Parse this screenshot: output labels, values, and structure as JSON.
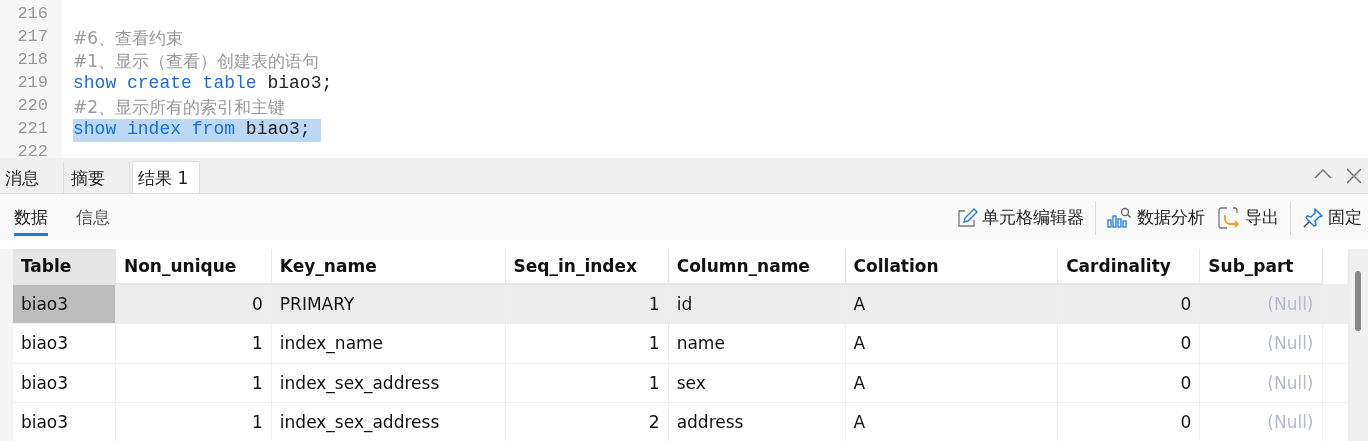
{
  "editor": {
    "lines": [
      {
        "number": "216",
        "selected": false
      },
      {
        "number": "217",
        "selected": false,
        "segments": [
          {
            "kind": "comment",
            "text": "#6、查看约束"
          }
        ]
      },
      {
        "number": "218",
        "selected": false,
        "segments": [
          {
            "kind": "comment",
            "text": "#1、显示（查看）创建表的语句"
          }
        ]
      },
      {
        "number": "219",
        "selected": false,
        "segments": [
          {
            "kind": "keyword",
            "text": "show create table"
          },
          {
            "kind": "plain",
            "text": " biao3;"
          }
        ]
      },
      {
        "number": "220",
        "selected": false,
        "segments": [
          {
            "kind": "comment",
            "text": "#2、显示所有的索引和主键"
          }
        ]
      },
      {
        "number": "221",
        "selected": true,
        "segments": [
          {
            "kind": "keyword",
            "text": "show index from"
          },
          {
            "kind": "plain",
            "text": " biao3; "
          }
        ]
      },
      {
        "number": "222",
        "selected": false
      }
    ]
  },
  "result_tabs": [
    {
      "label": "消息",
      "selected": false
    },
    {
      "label": "摘要",
      "selected": false
    },
    {
      "label": "结果 1",
      "selected": true
    }
  ],
  "view_tabs": [
    {
      "label": "数据",
      "selected": true
    },
    {
      "label": "信息",
      "selected": false
    }
  ],
  "toolbar": [
    {
      "kind": "edit",
      "label": "单元格编辑器"
    },
    {
      "kind": "analyze",
      "label": "数据分析"
    },
    {
      "kind": "export",
      "label": "导出"
    },
    {
      "kind": "pin",
      "label": "固定"
    }
  ],
  "table": {
    "columns": [
      {
        "label": "Table",
        "kind": "text"
      },
      {
        "label": "Non_unique",
        "kind": "number"
      },
      {
        "label": "Key_name",
        "kind": "text"
      },
      {
        "label": "Seq_in_index",
        "kind": "number"
      },
      {
        "label": "Column_name",
        "kind": "text"
      },
      {
        "label": "Collation",
        "kind": "text"
      },
      {
        "label": "Cardinality",
        "kind": "number"
      },
      {
        "label": "Sub_part",
        "kind": "number"
      }
    ],
    "rows": [
      {
        "selected": true,
        "cells": [
          "biao3",
          "0",
          "PRIMARY",
          "1",
          "id",
          "A",
          "0",
          {
            "value": "(Null)",
            "kind": "null"
          }
        ]
      },
      {
        "selected": false,
        "cells": [
          "biao3",
          "1",
          "index_name",
          "1",
          "name",
          "A",
          "0",
          {
            "value": "(Null)",
            "kind": "null"
          }
        ]
      },
      {
        "selected": false,
        "cells": [
          "biao3",
          "1",
          "index_sex_address",
          "1",
          "sex",
          "A",
          "0",
          {
            "value": "(Null)",
            "kind": "null"
          }
        ]
      },
      {
        "selected": false,
        "cells": [
          "biao3",
          "1",
          "index_sex_address",
          "2",
          "address",
          "A",
          "0",
          {
            "value": "(Null)",
            "kind": "null"
          }
        ]
      }
    ]
  }
}
